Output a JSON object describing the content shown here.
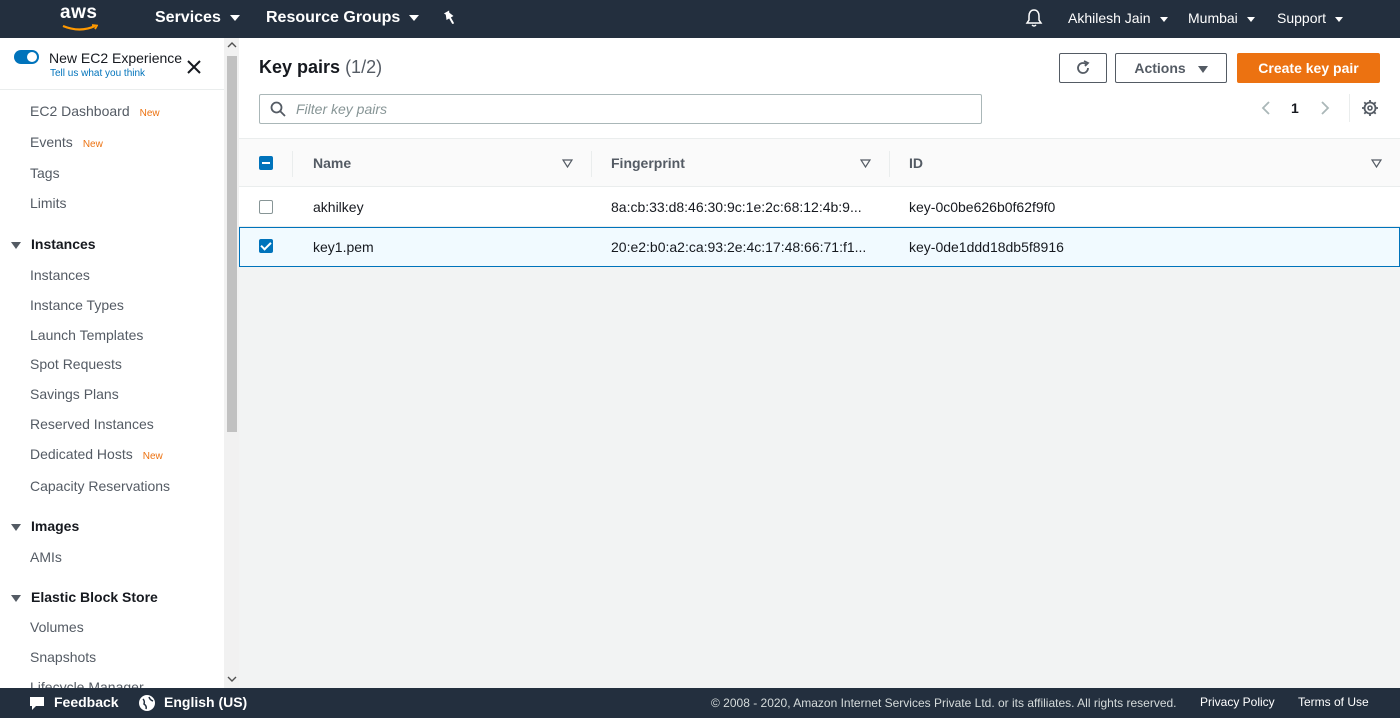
{
  "topnav": {
    "logo": "aws",
    "services": "Services",
    "resource_groups": "Resource Groups",
    "user": "Akhilesh Jain",
    "region": "Mumbai",
    "support": "Support",
    "icons": [
      "pin-icon",
      "bell-icon"
    ]
  },
  "sidebar": {
    "experience_title": "New EC2 Experience",
    "experience_sub": "Tell us what you think",
    "new_badge": "New",
    "links_top": [
      {
        "label": "EC2 Dashboard",
        "badge": "New"
      },
      {
        "label": "Events",
        "badge": "New"
      },
      {
        "label": "Tags",
        "badge": ""
      },
      {
        "label": "Limits",
        "badge": ""
      }
    ],
    "sections": [
      {
        "title": "Instances",
        "items": [
          "Instances",
          "Instance Types",
          "Launch Templates",
          "Spot Requests",
          "Savings Plans",
          "Reserved Instances",
          "Dedicated Hosts",
          "Capacity Reservations"
        ]
      },
      {
        "title": "Images",
        "items": [
          "AMIs"
        ]
      },
      {
        "title": "Elastic Block Store",
        "items": [
          "Volumes",
          "Snapshots",
          "Lifecycle Manager"
        ]
      }
    ],
    "dedicated_hosts_badge": "New"
  },
  "main": {
    "title": "Key pairs",
    "count": "(1/2)",
    "actions_label": "Actions",
    "create_label": "Create key pair",
    "search_placeholder": "Filter key pairs",
    "page": "1",
    "columns": [
      "Name",
      "Fingerprint",
      "ID"
    ],
    "rows": [
      {
        "name": "akhilkey",
        "fingerprint": "8a:cb:33:d8:46:30:9c:1e:2c:68:12:4b:9...",
        "id": "key-0c0be626b0f62f9f0",
        "selected": false
      },
      {
        "name": "key1.pem",
        "fingerprint": "20:e2:b0:a2:ca:93:2e:4c:17:48:66:71:f1...",
        "id": "key-0de1ddd18db5f8916",
        "selected": true
      }
    ]
  },
  "footer": {
    "feedback": "Feedback",
    "language": "English (US)",
    "copyright": "© 2008 - 2020, Amazon Internet Services Private Ltd. or its affiliates. All rights reserved.",
    "privacy": "Privacy Policy",
    "terms": "Terms of Use"
  },
  "colors": {
    "nav_bg": "#232f3e",
    "accent": "#0073bb",
    "primary_button": "#ec7211",
    "new_badge": "#ec7211"
  }
}
